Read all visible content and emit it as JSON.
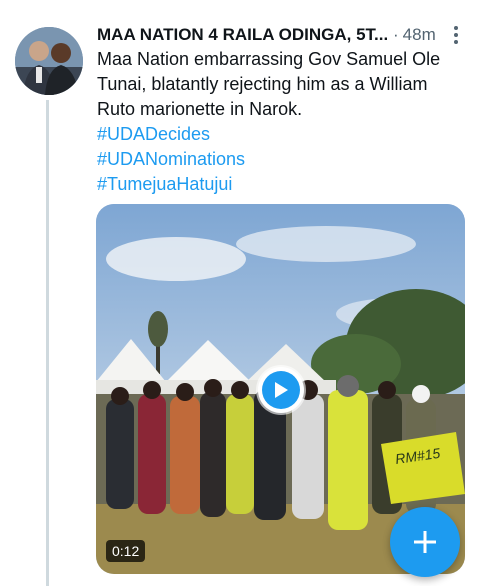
{
  "tweet": {
    "author": "MAA NATION 4 RAILA ODINGA, 5T...",
    "separator": "·",
    "time": "48m",
    "text": "Maa Nation embarrassing Gov Samuel Ole Tunai, blatantly rejecting him as a William Ruto marionette in Narok.",
    "hashtags": [
      "#UDADecides",
      "#UDANominations",
      "#TumejuaHatujui"
    ]
  },
  "media": {
    "duration": "0:12",
    "banner_text": "RM#15"
  },
  "icons": {
    "more": "more-vertical-icon",
    "play": "play-icon",
    "compose": "plus-icon"
  },
  "colors": {
    "accent": "#1d9bf0",
    "text": "#0f1419",
    "secondary": "#536471"
  }
}
